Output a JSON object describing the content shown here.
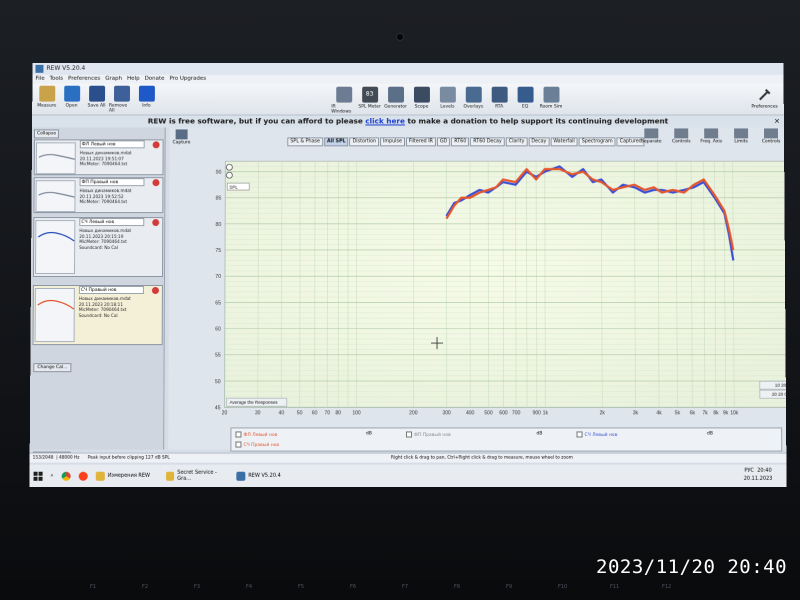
{
  "window": {
    "title": "REW V5.20.4"
  },
  "menu": [
    "File",
    "Tools",
    "Preferences",
    "Graph",
    "Help",
    "Donate",
    "Pro Upgrades"
  ],
  "toolbar": {
    "left": [
      {
        "label": "Measure",
        "color": "#c9a24a"
      },
      {
        "label": "Open",
        "color": "#2a6fc2"
      },
      {
        "label": "Save All",
        "color": "#2b4e8d"
      },
      {
        "label": "Remove All",
        "color": "#3d5f9a"
      },
      {
        "label": "Info",
        "color": "#1f59c7"
      }
    ],
    "center": [
      {
        "label": "IR Windows",
        "color": "#6d7c92"
      },
      {
        "label": "SPL Meter",
        "color": "#424a55",
        "value": "83"
      },
      {
        "label": "Generator",
        "color": "#5c6f88"
      },
      {
        "label": "Scope",
        "color": "#3a4b62"
      },
      {
        "label": "Levels",
        "color": "#7a8aa0"
      },
      {
        "label": "Overlays",
        "color": "#4a6b91"
      },
      {
        "label": "RTA",
        "color": "#3f5a80"
      },
      {
        "label": "EQ",
        "color": "#355c8c"
      },
      {
        "label": "Room Sim",
        "color": "#6b7f97"
      }
    ],
    "right": {
      "label": "Preferences"
    }
  },
  "banner": {
    "pre": "REW is free software, but if you can afford to please ",
    "link": "click here",
    "post": " to make a donation to help support its continuing development"
  },
  "left_panel": {
    "collapse": "Collapse",
    "change_cal": "Change Cal...",
    "measurements": [
      {
        "name": "ФЛ Левый нов",
        "file": "Новых динамиков.mdat",
        "date": "20.11.2023 19:51:07",
        "mic": "MicMeter: 7090464.txt",
        "sound": ""
      },
      {
        "name": "ФП Правый нов",
        "file": "Новых динамиков.mdat",
        "date": "20.11.2023 19:52:52",
        "mic": "MicMeter: 7090464.txt",
        "sound": ""
      },
      {
        "name": "СЧ Левый нов",
        "file": "Новых динамиков.mdat",
        "date": "20.11.2023 20:15:19",
        "mic": "MicMeter: 7090464.txt",
        "sound": "Soundcard: No Cal"
      },
      {
        "name": "СЧ Правый нов",
        "file": "Новых динамиков.mdat",
        "date": "20.11.2023 20:18:11",
        "mic": "MicMeter: 7090464.txt",
        "sound": "Soundcard: No Cal"
      }
    ]
  },
  "graph": {
    "capture": "Capture",
    "tabs": [
      "SPL & Phase",
      "All SPL",
      "Distortion",
      "Impulse",
      "Filtered IR",
      "GD",
      "RT60",
      "RT60 Decay",
      "Clarity",
      "Decay",
      "Waterfall",
      "Spectrogram",
      "Captured"
    ],
    "active_tab": "All SPL",
    "tools": [
      "Separate",
      "Controls",
      "Freq. Axis",
      "Limits",
      "Controls"
    ],
    "spl_dropdown": "SPL",
    "average_button": "Average the Responses",
    "range_buttons": [
      "10 200",
      "20 20 000"
    ]
  },
  "chart_data": {
    "type": "line",
    "xlabel": "",
    "ylabel": "",
    "xscale": "log",
    "xlim": [
      20,
      24000
    ],
    "ylim": [
      45,
      92
    ],
    "x_ticks": [
      20,
      30,
      40,
      50,
      60,
      70,
      80,
      100,
      200,
      300,
      400,
      500,
      600,
      700,
      900,
      1000,
      2000,
      3000,
      4000,
      5000,
      6000,
      7000,
      8000,
      9000,
      10000,
      20000
    ],
    "x_tick_labels": [
      "20",
      "30",
      "40",
      "50",
      "60",
      "70",
      "80",
      "100",
      "200",
      "300",
      "400",
      "500",
      "600",
      "700",
      "900",
      "1k",
      "2k",
      "3k",
      "4k",
      "5k",
      "6k",
      "7k",
      "8k",
      "9k",
      "10k",
      "20k"
    ],
    "y_ticks": [
      45,
      50,
      55,
      60,
      65,
      70,
      75,
      80,
      85,
      90
    ],
    "y_tick_labels": [
      "45",
      "50",
      "55",
      "60",
      "65",
      "70",
      "75",
      "80",
      "85",
      "90"
    ],
    "grid": true,
    "series": [
      {
        "name": "СЧ Левый нов",
        "color": "#3a4fd6",
        "x": [
          300,
          330,
          360,
          400,
          450,
          500,
          550,
          600,
          700,
          800,
          900,
          1000,
          1200,
          1400,
          1600,
          1800,
          2000,
          2300,
          2600,
          3000,
          3400,
          3800,
          4200,
          4800,
          5500,
          6200,
          7000,
          8000,
          9000,
          9500,
          10000
        ],
        "y": [
          81.5,
          84,
          84.5,
          85.5,
          86.5,
          86,
          87,
          88,
          87.5,
          90,
          89,
          90,
          91,
          89,
          90.5,
          88,
          88.5,
          86,
          87.5,
          87,
          86,
          86.5,
          86.5,
          86,
          86.5,
          87,
          88,
          85,
          82,
          78,
          73
        ]
      },
      {
        "name": "СЧ Правый нов",
        "color": "#e4572e",
        "x": [
          300,
          330,
          360,
          400,
          450,
          500,
          550,
          600,
          700,
          800,
          900,
          1000,
          1200,
          1400,
          1600,
          1800,
          2000,
          2300,
          2600,
          3000,
          3400,
          3800,
          4200,
          4800,
          5500,
          6200,
          7000,
          8000,
          9000,
          9500,
          10000
        ],
        "y": [
          81,
          83.5,
          85,
          85,
          86,
          86.5,
          87,
          88.5,
          88,
          90.5,
          88.5,
          90.5,
          90.5,
          89.5,
          90,
          88.5,
          88,
          86.5,
          87,
          87.5,
          86.5,
          87,
          86,
          86.5,
          86,
          87.5,
          88.5,
          85.5,
          82.5,
          79,
          75
        ]
      }
    ]
  },
  "legend": [
    {
      "name": "ФЛ Левый нов",
      "color": "#e4572e",
      "value": "dB"
    },
    {
      "name": "ФП Правый нов",
      "color": "#888888",
      "value": "dB"
    },
    {
      "name": "СЧ Левый нов",
      "color": "#3a4fd6",
      "value": "dB"
    }
  ],
  "statusbar": {
    "mem": "153/2048",
    "rate": "48000 Hz",
    "peak": "Peak input before clipping 127 dB SPL",
    "hint": "Right click & drag to pan, Ctrl+Right click & drag to measure, mouse wheel to zoom"
  },
  "taskbar": {
    "items": [
      {
        "label": "Измерения REW",
        "color": "#e0b43b"
      },
      {
        "label": "Secret Service - Gra...",
        "color": "#e0b43b"
      },
      {
        "label": "REW V5.20.4",
        "color": "#3a6ea5"
      }
    ],
    "lang": "РУС",
    "time": "20:40",
    "date": "20.11.2023"
  },
  "photo_stamp": "2023/11/20  20:40",
  "fkeys": [
    "F1",
    "F2",
    "F3",
    "F4",
    "F5",
    "F6",
    "F7",
    "F8",
    "F9",
    "F10",
    "F11",
    "F12"
  ]
}
